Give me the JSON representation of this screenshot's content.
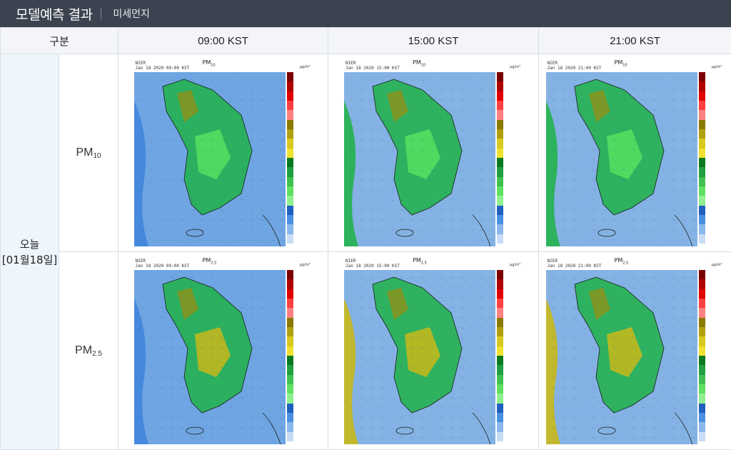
{
  "header": {
    "title": "모델예측 결과",
    "subtitle": "미세먼지"
  },
  "table": {
    "col_header": "구분",
    "times": [
      "09:00 KST",
      "15:00 KST",
      "21:00 KST"
    ],
    "day_label": "오늘",
    "day_date": "[01월18일]",
    "rows": [
      {
        "name": "PM",
        "sub": "10"
      },
      {
        "name": "PM",
        "sub": "2.5"
      }
    ]
  },
  "maps": {
    "source": "NIER",
    "unit": "μg/m³",
    "pm10_title": "PM",
    "pm10_sub": "10",
    "pm25_title": "PM",
    "pm25_sub": "2.5",
    "stamps": [
      "Jan 18 2020 09:00 KST",
      "Jan 18 2020 15:00 KST",
      "Jan 18 2020 21:00 KST"
    ]
  },
  "colors": {
    "sea_light": "#a9c9e8",
    "sea_blue": "#3f86dd",
    "land_green": "#22b24c",
    "land_light": "#55e060",
    "yellow": "#c9b81a",
    "olive": "#9e8d0f"
  }
}
